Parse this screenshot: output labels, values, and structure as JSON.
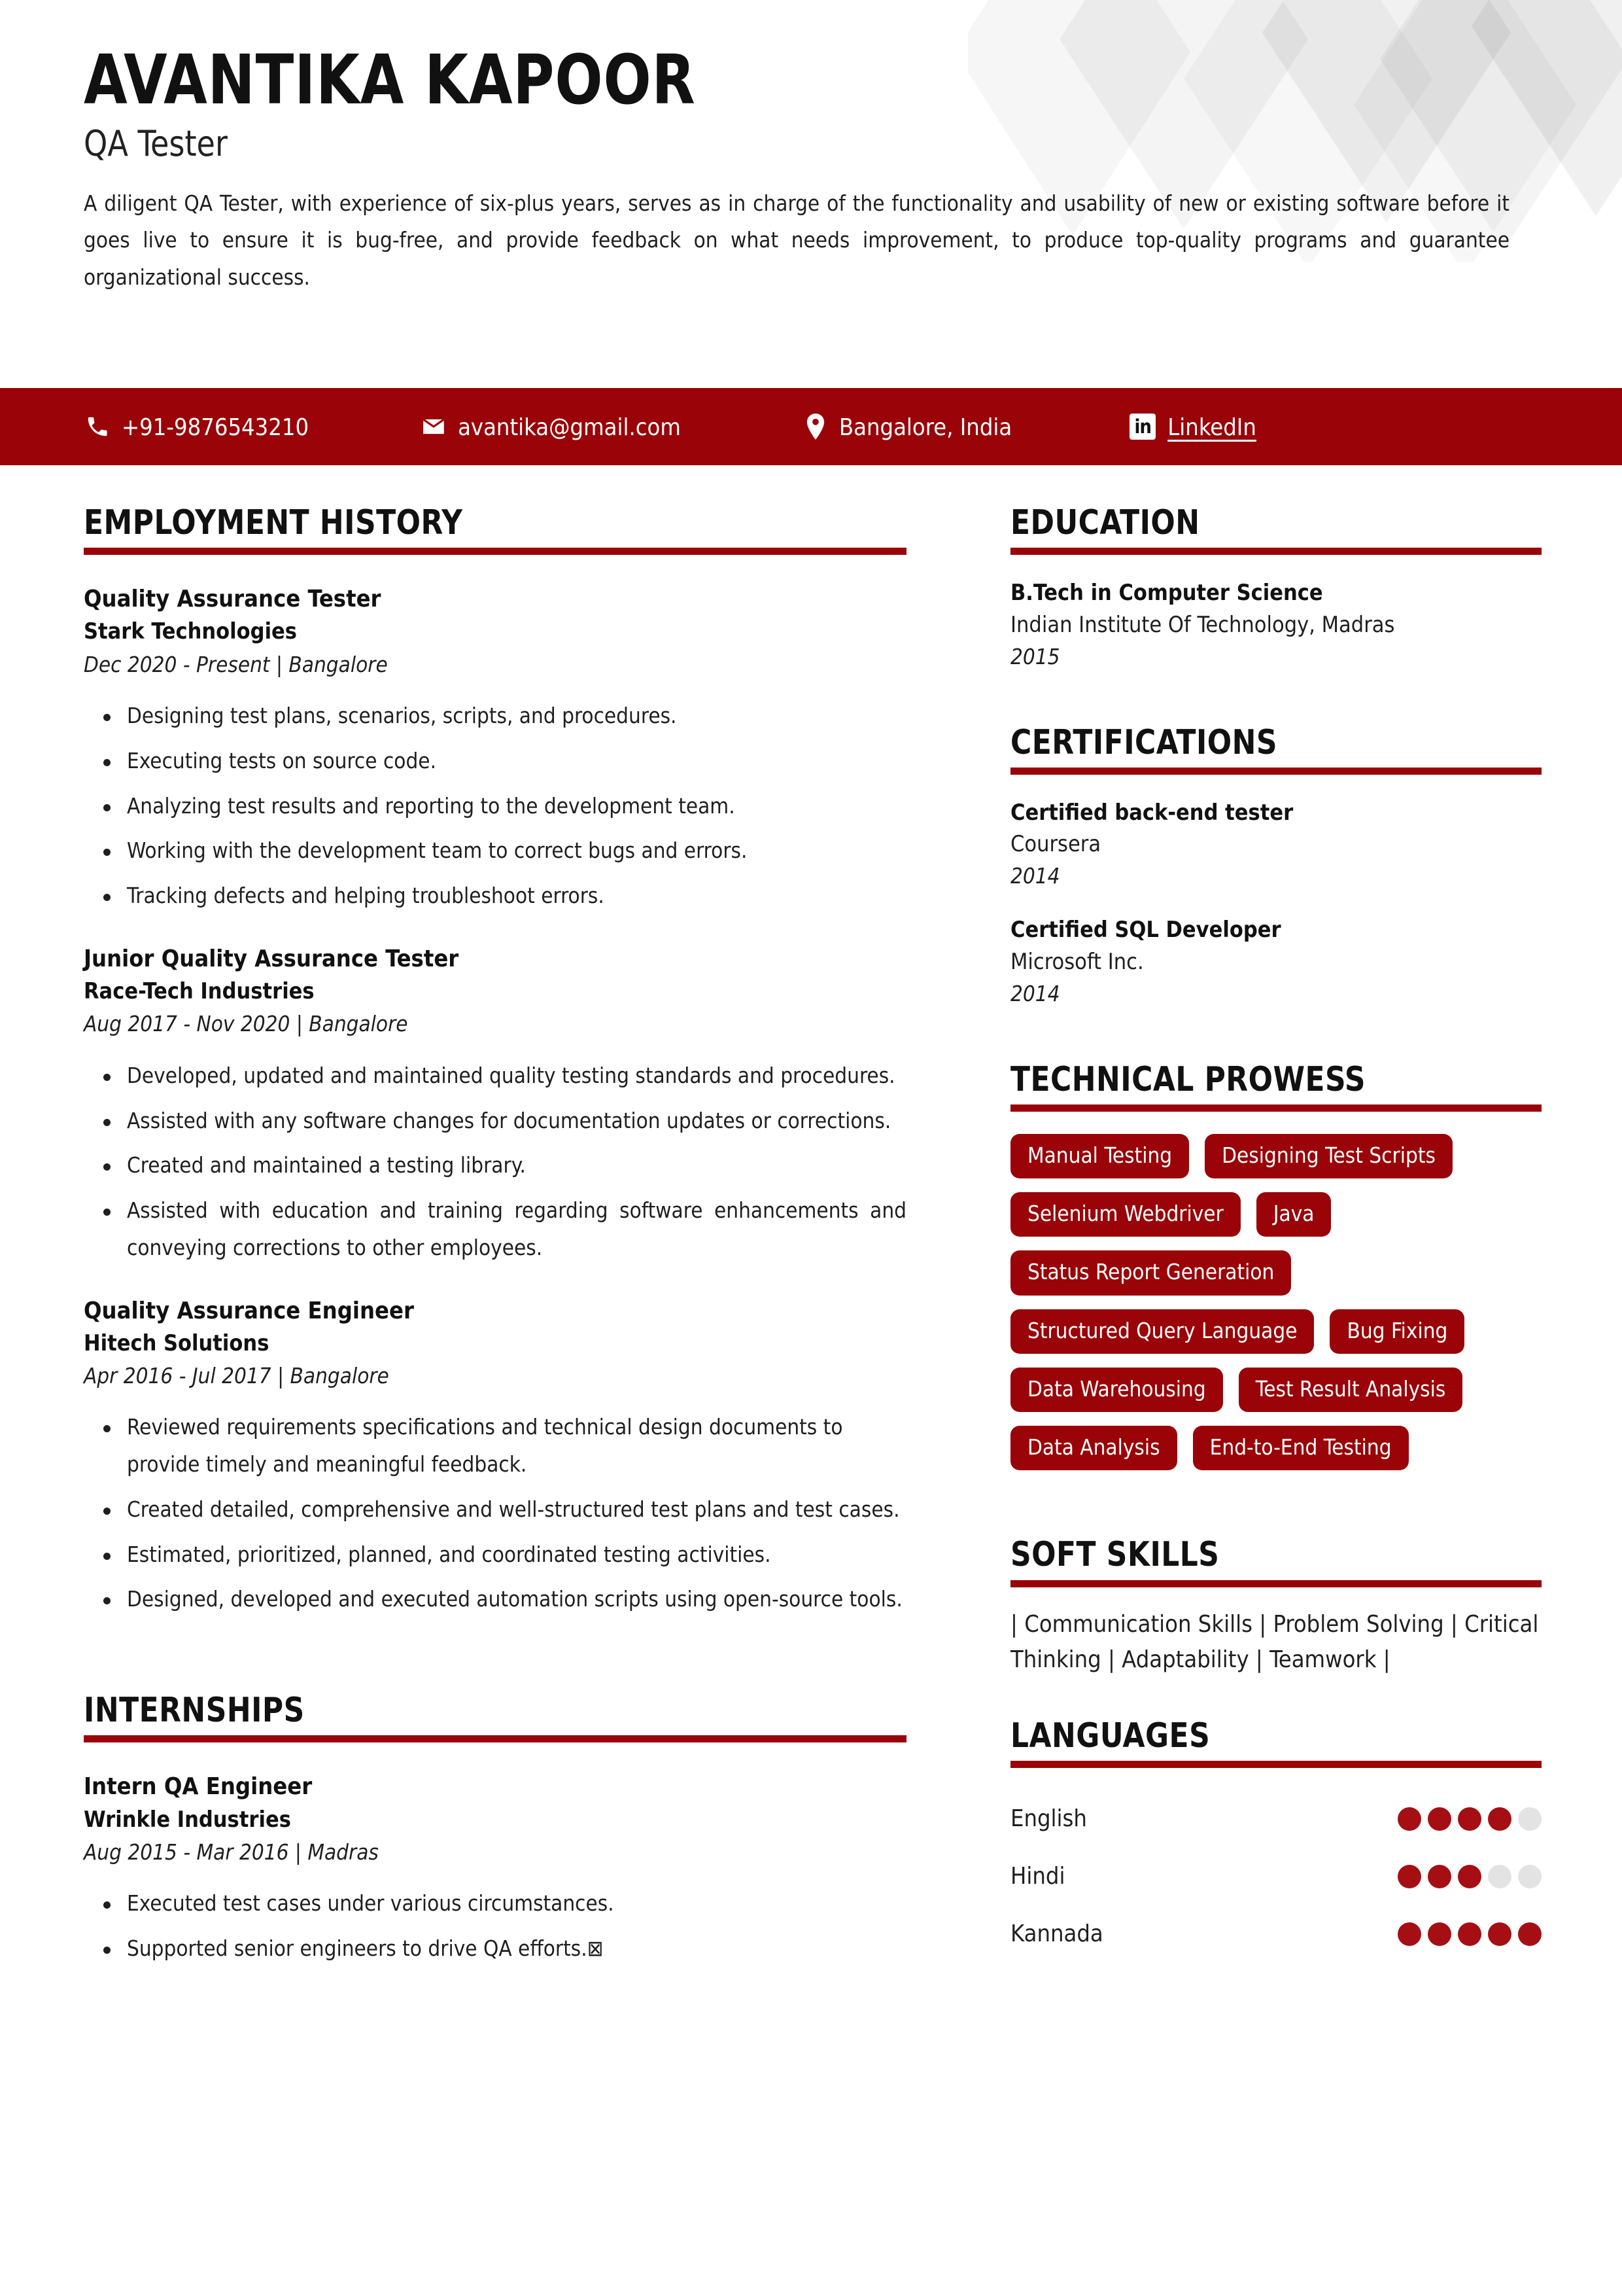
{
  "header": {
    "name": "AVANTIKA KAPOOR",
    "role": "QA Tester",
    "summary": "A diligent QA Tester, with experience of six-plus years, serves as in charge of the functionality and usability of new or existing software before it goes live to ensure it is bug-free, and provide feedback on what needs improvement,  to produce top-quality programs and guarantee organizational success."
  },
  "contact": {
    "phone": "+91-9876543210",
    "email": "avantika@gmail.com",
    "location": "Bangalore, India",
    "linkedin": "LinkedIn",
    "linkedin_badge": "in",
    "icons": {
      "phone": "phone-icon",
      "email": "envelope-icon",
      "location": "map-pin-icon",
      "linkedin": "linkedin-icon"
    },
    "bar_color": "#9A0308"
  },
  "sections": {
    "employment_history": "EMPLOYMENT HISTORY",
    "internships": "INTERNSHIPS",
    "education": "EDUCATION",
    "certifications": "CERTIFICATIONS",
    "technical_prowess": "TECHNICAL PROWESS",
    "soft_skills": "SOFT SKILLS",
    "languages": "LANGUAGES"
  },
  "employment": [
    {
      "title": "Quality Assurance Tester",
      "company": "Stark Technologies",
      "meta": "Dec 2020 - Present | Bangalore",
      "bullets": [
        "Designing test plans, scenarios, scripts, and procedures.",
        "Executing tests on source code.",
        "Analyzing test results and reporting to the development team.",
        "Working with the development team to correct bugs and errors.",
        "Tracking defects and helping troubleshoot errors."
      ]
    },
    {
      "title": "Junior Quality Assurance Tester",
      "company": "Race-Tech Industries",
      "meta": "Aug 2017 - Nov 2020 | Bangalore",
      "bullets": [
        "Developed, updated and maintained quality testing standards and procedures.",
        "Assisted with any software changes for documentation updates or corrections.",
        "Created and maintained a testing library.",
        "Assisted with education and training regarding software enhancements and conveying corrections to other employees."
      ]
    },
    {
      "title": "Quality Assurance Engineer",
      "company": "Hitech Solutions",
      "meta": "Apr 2016 - Jul 2017 | Bangalore",
      "bullets": [
        "Reviewed requirements specifications and technical design documents to provide timely and meaningful feedback.",
        "Created detailed, comprehensive and well-structured test plans and test cases.",
        "Estimated, prioritized, planned, and coordinated testing activities.",
        "Designed, developed and executed automation scripts using open-source tools."
      ]
    }
  ],
  "internships": [
    {
      "title": "Intern QA Engineer",
      "company": "Wrinkle Industries",
      "meta": "Aug 2015 - Mar 2016 | Madras",
      "bullets": [
        "Executed test cases under various circumstances.",
        "Supported senior engineers to drive QA efforts.⊠"
      ]
    }
  ],
  "education": [
    {
      "degree": "B.Tech in Computer Science",
      "institution": "Indian Institute Of Technology, Madras",
      "year": "2015"
    }
  ],
  "certifications": [
    {
      "name": "Certified back-end tester",
      "issuer": "Coursera",
      "year": "2014"
    },
    {
      "name": "Certified SQL Developer",
      "issuer": "Microsoft Inc.",
      "year": "2014"
    }
  ],
  "technical_prowess": [
    "Manual Testing",
    "Designing Test Scripts",
    "Selenium Webdriver",
    "Java",
    "Status Report Generation",
    "Structured Query Language",
    "Bug Fixing",
    "Data Warehousing",
    "Test Result Analysis",
    "Data Analysis",
    "End-to-End Testing"
  ],
  "soft_skills_text": "| Communication Skills | Problem Solving | Critical Thinking | Adaptability | Teamwork |",
  "languages": [
    {
      "name": "English",
      "level": 4,
      "max": 5
    },
    {
      "name": "Hindi",
      "level": 3,
      "max": 5
    },
    {
      "name": "Kannada",
      "level": 5,
      "max": 5
    }
  ],
  "colors": {
    "accent": "#9A0308",
    "dot_filled": "#A50E12",
    "dot_empty": "#E3E3E3",
    "text": "#1f1f1f"
  }
}
